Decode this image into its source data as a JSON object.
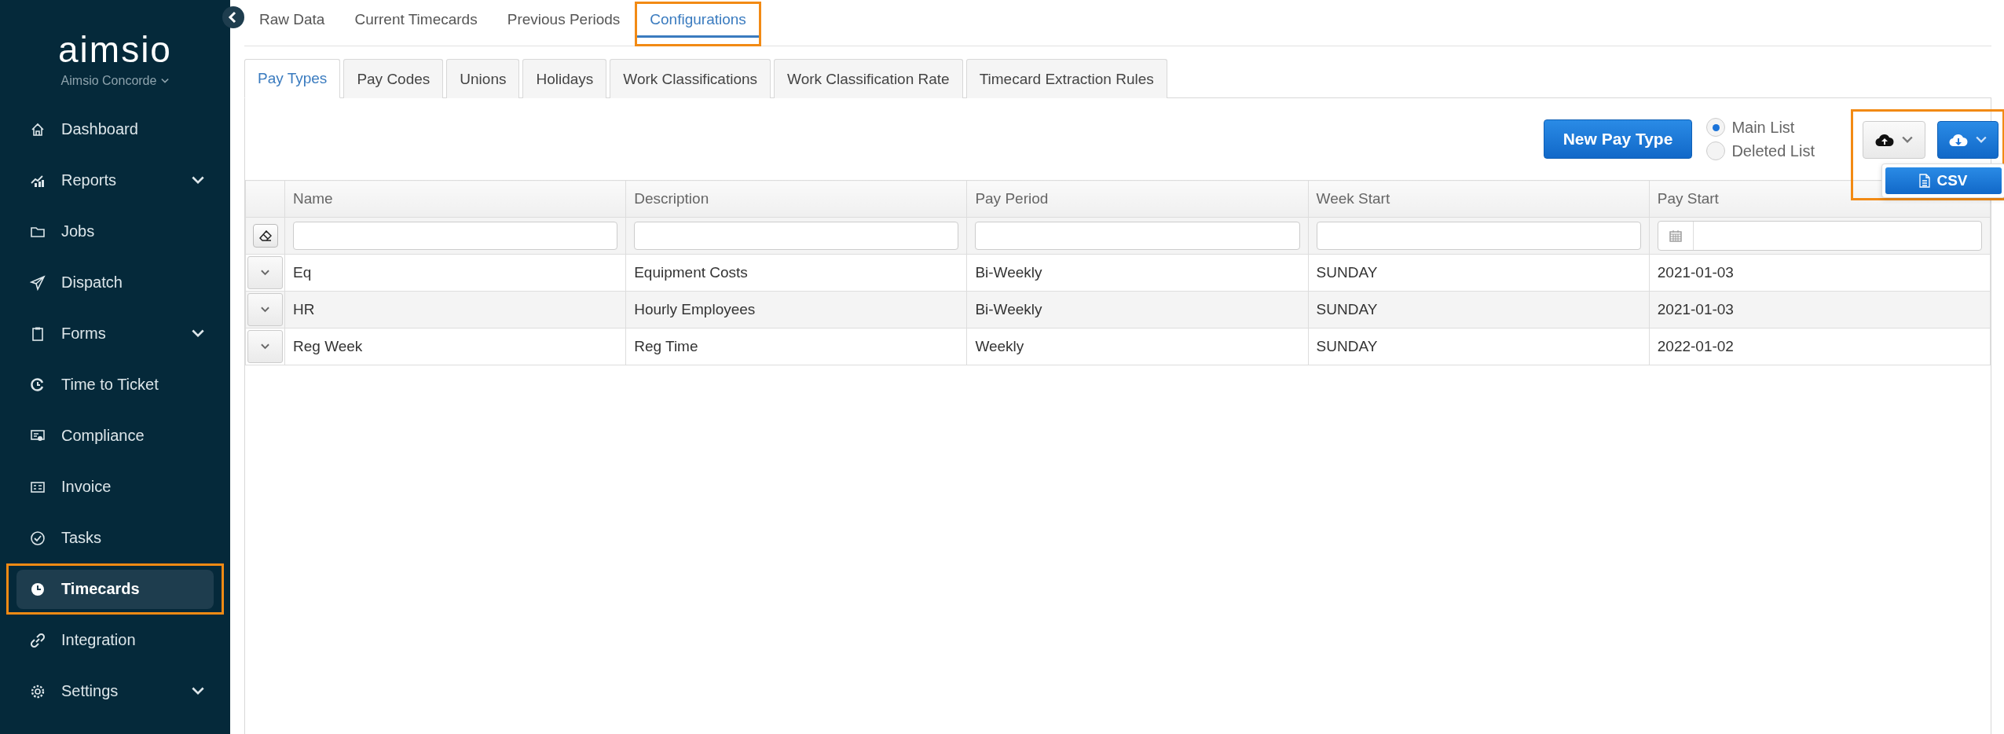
{
  "sidebar": {
    "logo": "aimsio",
    "org": "Aimsio Concorde",
    "items": [
      {
        "label": "Dashboard",
        "has_submenu": false,
        "selected": false,
        "highlighted": false
      },
      {
        "label": "Reports",
        "has_submenu": true,
        "selected": false,
        "highlighted": false
      },
      {
        "label": "Jobs",
        "has_submenu": false,
        "selected": false,
        "highlighted": false
      },
      {
        "label": "Dispatch",
        "has_submenu": false,
        "selected": false,
        "highlighted": false
      },
      {
        "label": "Forms",
        "has_submenu": true,
        "selected": false,
        "highlighted": false
      },
      {
        "label": "Time to Ticket",
        "has_submenu": false,
        "selected": false,
        "highlighted": false
      },
      {
        "label": "Compliance",
        "has_submenu": false,
        "selected": false,
        "highlighted": false
      },
      {
        "label": "Invoice",
        "has_submenu": false,
        "selected": false,
        "highlighted": false
      },
      {
        "label": "Tasks",
        "has_submenu": false,
        "selected": false,
        "highlighted": false
      },
      {
        "label": "Timecards",
        "has_submenu": false,
        "selected": true,
        "highlighted": true
      },
      {
        "label": "Integration",
        "has_submenu": false,
        "selected": false,
        "highlighted": false
      },
      {
        "label": "Settings",
        "has_submenu": true,
        "selected": false,
        "highlighted": false
      }
    ]
  },
  "tabs": [
    {
      "label": "Raw Data",
      "selected": false,
      "highlighted": false
    },
    {
      "label": "Current Timecards",
      "selected": false,
      "highlighted": false
    },
    {
      "label": "Previous Periods",
      "selected": false,
      "highlighted": false
    },
    {
      "label": "Configurations",
      "selected": true,
      "highlighted": true
    }
  ],
  "sub_tabs": [
    {
      "label": "Pay Types",
      "selected": true
    },
    {
      "label": "Pay Codes",
      "selected": false
    },
    {
      "label": "Unions",
      "selected": false
    },
    {
      "label": "Holidays",
      "selected": false
    },
    {
      "label": "Work Classifications",
      "selected": false
    },
    {
      "label": "Work Classification Rate",
      "selected": false
    },
    {
      "label": "Timecard Extraction Rules",
      "selected": false
    }
  ],
  "toolbar": {
    "new_button": "New Pay Type",
    "list_options": [
      {
        "label": "Main List",
        "selected": true
      },
      {
        "label": "Deleted List",
        "selected": false
      }
    ],
    "export": {
      "highlighted": true,
      "menu": [
        "CSV"
      ]
    }
  },
  "table": {
    "columns": [
      "Name",
      "Description",
      "Pay Period",
      "Week Start",
      "Pay Start"
    ],
    "filters": [
      {
        "kind": "text"
      },
      {
        "kind": "text"
      },
      {
        "kind": "text"
      },
      {
        "kind": "text"
      },
      {
        "kind": "date"
      }
    ],
    "rows": [
      [
        "Eq",
        "Equipment Costs",
        "Bi-Weekly",
        "SUNDAY",
        "2021-01-03"
      ],
      [
        "HR",
        "Hourly Employees",
        "Bi-Weekly",
        "SUNDAY",
        "2021-01-03"
      ],
      [
        "Reg Week",
        "Reg Time",
        "Weekly",
        "SUNDAY",
        "2022-01-02"
      ]
    ]
  }
}
